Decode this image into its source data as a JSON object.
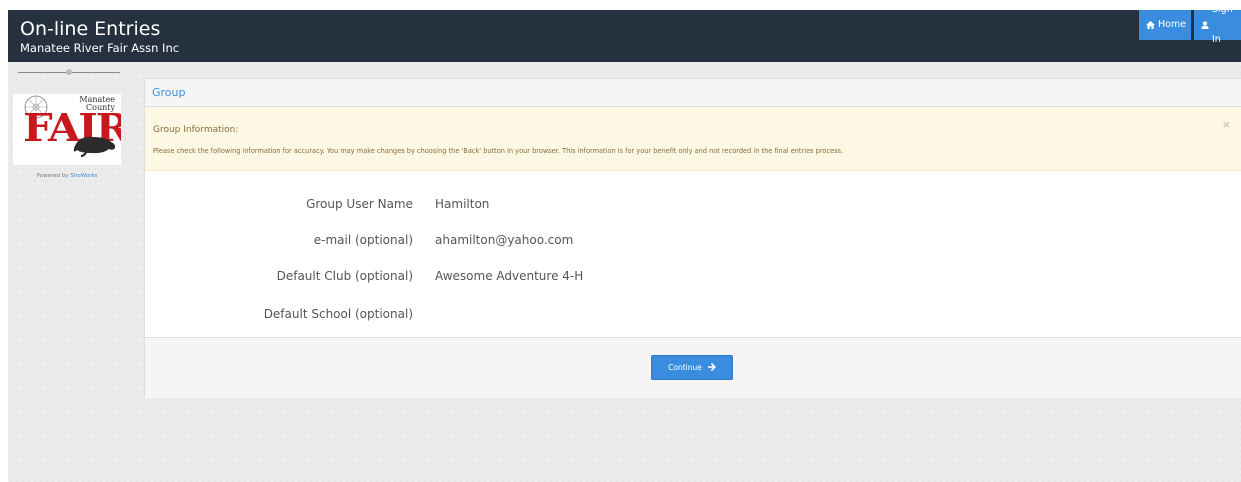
{
  "header": {
    "title": "On-line Entries",
    "subtitle": "Manatee River Fair Assn Inc",
    "nav": {
      "home_label": "Home",
      "signin_label": "Sign In"
    }
  },
  "sidebar": {
    "logo": {
      "line1": "Manatee",
      "line2": "County",
      "word": "FAIR"
    },
    "powered_by": "Powered by",
    "powered_link": "ShoWorks"
  },
  "panel": {
    "heading": "Group",
    "alert": {
      "title": "Group Information:",
      "text": "Please check the following information for accuracy. You may make changes by choosing the 'Back' button in your browser. This information is for your benefit only and not recorded in the final entries process.",
      "close": "×"
    },
    "fields": [
      {
        "label": "Group User Name",
        "value": "Hamilton"
      },
      {
        "label": "e-mail (optional)",
        "value": "ahamilton@yahoo.com"
      },
      {
        "label": "Default Club (optional)",
        "value": "Awesome Adventure 4-H"
      },
      {
        "label": "Default School (optional)",
        "value": ""
      }
    ],
    "continue_label": "Continue"
  },
  "colors": {
    "navbar": "#263140",
    "primary": "#3a8dde",
    "alert_bg": "#fcf8e3",
    "alert_text": "#8a6d3b",
    "fair_red": "#c8171d"
  },
  "icons": [
    "home-icon",
    "user-icon",
    "close-icon",
    "arrow-right-icon",
    "manatee-icon",
    "ferris-wheel-icon"
  ]
}
